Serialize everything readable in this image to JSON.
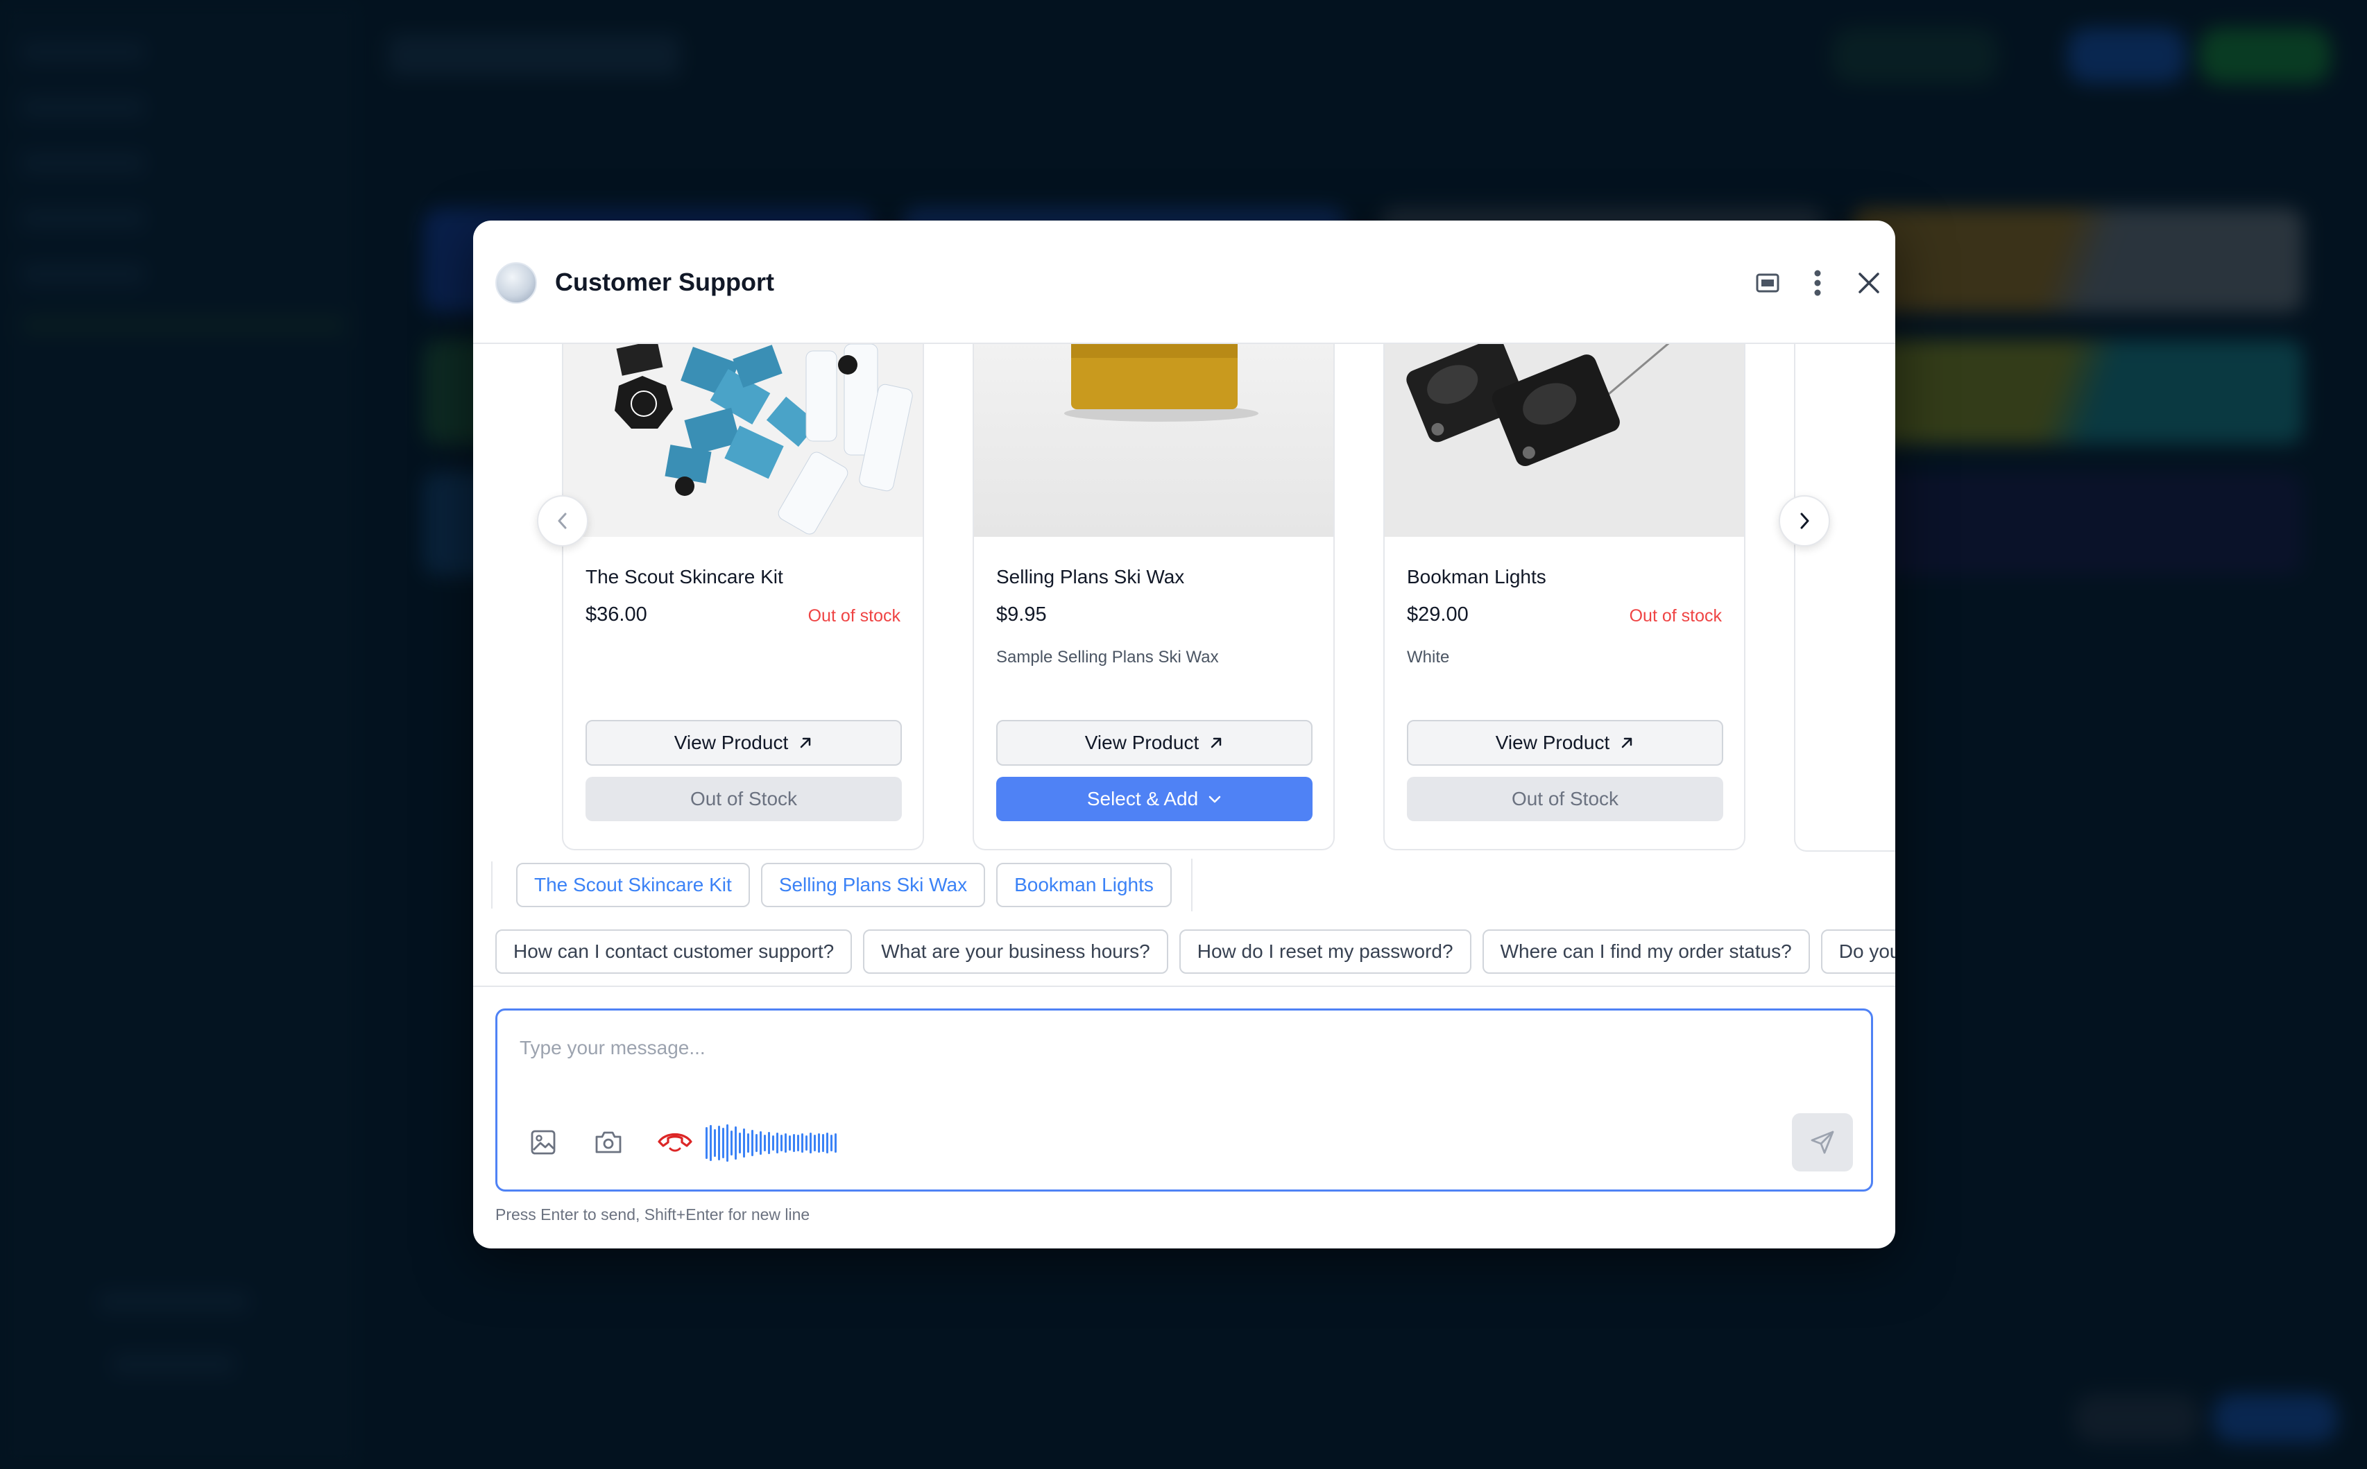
{
  "chat": {
    "title": "Customer Support"
  },
  "products": [
    {
      "name": "The Scout Skincare Kit",
      "price": "$36.00",
      "stock_label": "Out of stock",
      "description": "",
      "view_label": "View Product",
      "action_label": "Out of Stock",
      "action_type": "out-of-stock"
    },
    {
      "name": "Selling Plans Ski Wax",
      "price": "$9.95",
      "stock_label": "",
      "description": "Sample Selling Plans Ski Wax",
      "view_label": "View Product",
      "action_label": "Select & Add",
      "action_type": "add"
    },
    {
      "name": "Bookman Lights",
      "price": "$29.00",
      "stock_label": "Out of stock",
      "description": "White",
      "view_label": "View Product",
      "action_label": "Out of Stock",
      "action_type": "out-of-stock"
    }
  ],
  "product_chips": [
    "The Scout Skincare Kit",
    "Selling Plans Ski Wax",
    "Bookman Lights"
  ],
  "faq_chips": [
    "How can I contact customer support?",
    "What are your business hours?",
    "How do I reset my password?",
    "Where can I find my order status?",
    "Do you"
  ],
  "composer": {
    "placeholder": "Type your message...",
    "hint": "Press Enter to send, Shift+Enter for new line"
  },
  "colors": {
    "accent": "#4f82f5",
    "out_of_stock": "#ef4444",
    "voice_active": "#dc2626"
  },
  "icons": {
    "header": [
      "minimize-window-icon",
      "more-vertical-icon",
      "close-icon"
    ],
    "composer_tools": [
      "image-icon",
      "camera-icon",
      "end-voice-call-icon"
    ],
    "send": "send-icon"
  }
}
